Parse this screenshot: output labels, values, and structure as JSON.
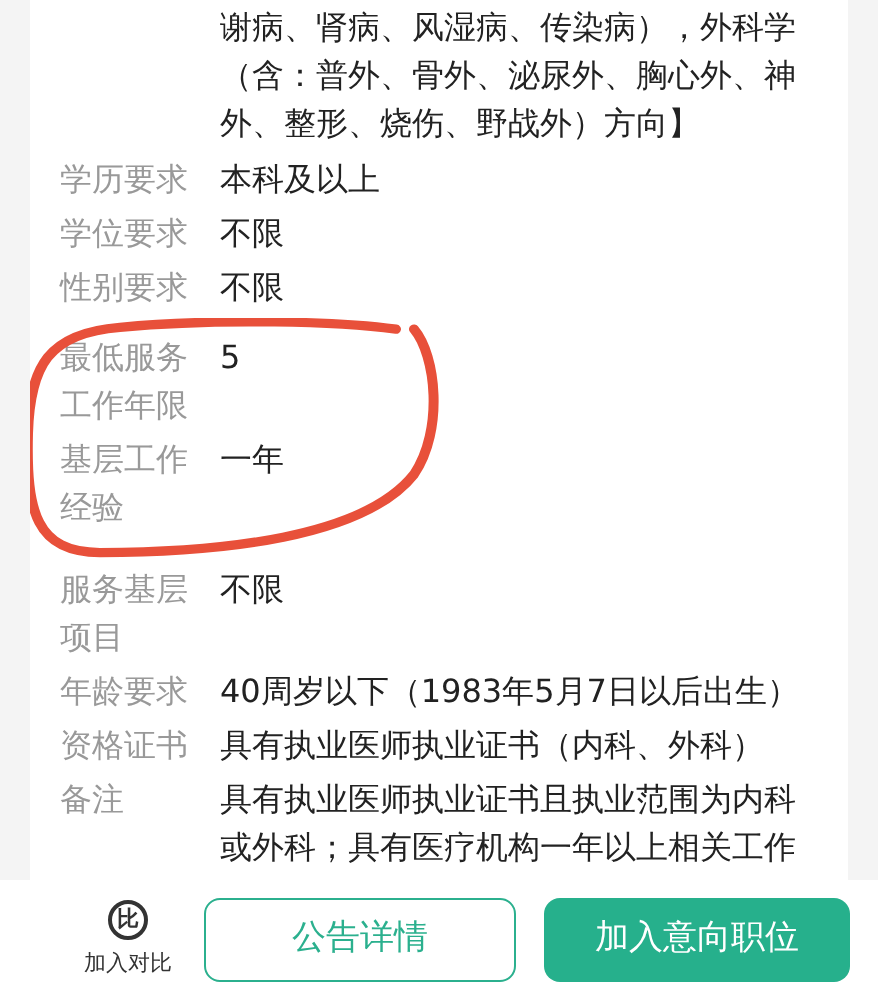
{
  "continued_text": "谢病、肾病、风湿病、传染病），外科学（含：普外、骨外、泌尿外、胸心外、神外、整形、烧伤、野战外）方向】",
  "rows": [
    {
      "label": "学历要求",
      "value": "本科及以上"
    },
    {
      "label": "学位要求",
      "value": "不限"
    },
    {
      "label": "性别要求",
      "value": "不限"
    },
    {
      "label": "最低服务工作年限",
      "value": "5",
      "circled": true
    },
    {
      "label": "基层工作经验",
      "value": "一年",
      "circled": true
    },
    {
      "label": "服务基层项目",
      "value": "不限"
    },
    {
      "label": "年龄要求",
      "value": "40周岁以下（1983年5月7日以后出生）"
    },
    {
      "label": "资格证书",
      "value": "具有执业医师执业证书（内科、外科）"
    },
    {
      "label": "备注",
      "value": "具有执业医师执业证书且执业范围为内科或外科；具有医疗机构一年以上相关工作"
    }
  ],
  "bottom_bar": {
    "compare": {
      "icon": "比",
      "label": "加入对比"
    },
    "buttons": [
      {
        "label": "公告详情",
        "kind": "outline"
      },
      {
        "label": "加入意向职位",
        "kind": "filled"
      }
    ]
  }
}
